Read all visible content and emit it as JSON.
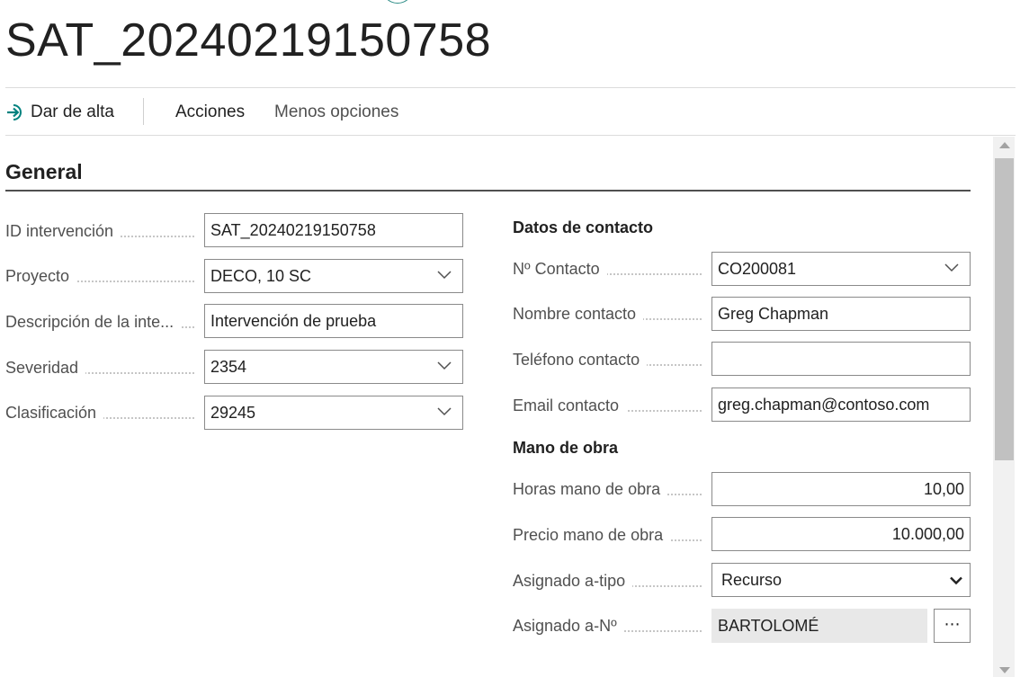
{
  "page": {
    "title": "SAT_20240219150758"
  },
  "actions": {
    "register_label": "Dar de alta",
    "actions_label": "Acciones",
    "less_options_label": "Menos opciones"
  },
  "section": {
    "title": "General"
  },
  "left_fields": [
    {
      "label": "ID intervención",
      "value": "SAT_20240219150758",
      "type": "text"
    },
    {
      "label": "Proyecto",
      "value": "DECO, 10 SC",
      "type": "dropdown"
    },
    {
      "label": "Descripción de la inte...",
      "value": "Intervención de prueba",
      "type": "text"
    },
    {
      "label": "Severidad",
      "value": "2354",
      "type": "dropdown"
    },
    {
      "label": "Clasificación",
      "value": "29245",
      "type": "dropdown"
    }
  ],
  "contact": {
    "title": "Datos de contacto",
    "fields": [
      {
        "label": "Nº Contacto",
        "value": "CO200081",
        "type": "dropdown"
      },
      {
        "label": "Nombre contacto",
        "value": "Greg Chapman",
        "type": "text"
      },
      {
        "label": "Teléfono contacto",
        "value": "",
        "type": "text"
      },
      {
        "label": "Email contacto",
        "value": "greg.chapman@contoso.com",
        "type": "text"
      }
    ]
  },
  "labor": {
    "title": "Mano de obra",
    "fields": [
      {
        "label": "Horas mano de obra",
        "value": "10,00",
        "type": "number"
      },
      {
        "label": "Precio mano de obra",
        "value": "10.000,00",
        "type": "number"
      },
      {
        "label": "Asignado a-tipo",
        "value": "Recurso",
        "type": "select"
      },
      {
        "label": "Asignado a-Nº",
        "value": "BARTOLOMÉ",
        "type": "lookup"
      }
    ]
  },
  "icons": {
    "register": "sign-in-arrow-icon",
    "dropdown": "chevron-down-icon",
    "lookup": "ellipsis-icon"
  },
  "colors": {
    "accent": "#00827f",
    "text": "#212121",
    "muted": "#505050",
    "readonly_bg": "#e8e8e8"
  }
}
